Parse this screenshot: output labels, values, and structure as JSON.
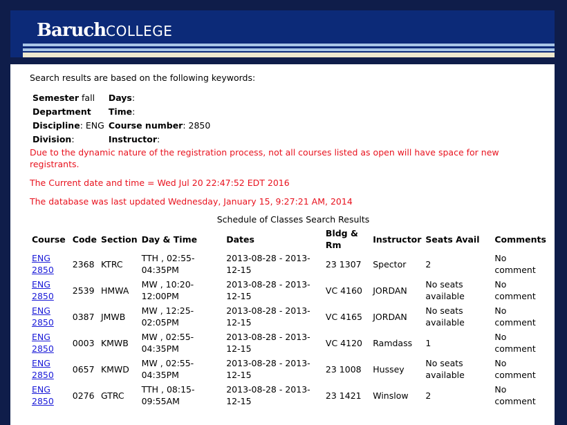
{
  "header": {
    "logo_bold": "Baruch",
    "logo_rest": "COLLEGE"
  },
  "colors": {
    "banner": "#0c2a78",
    "frame": "#0f1d4a",
    "stripe_light": "#a9c6e6",
    "stripe_cream": "#efe9cf",
    "warning": "#e8121e",
    "link": "#1a1ad8"
  },
  "intro": "Search results are based on the following keywords:",
  "criteria": {
    "semester_label": "Semester",
    "semester_value": "fall",
    "days_label": "Days",
    "days_value": "",
    "department_label": "Department",
    "time_label": "Time",
    "time_value": "",
    "discipline_label": "Discipline",
    "discipline_value": "ENG",
    "course_number_label": "Course number",
    "course_number_value": "2850",
    "division_label": "Division",
    "instructor_label": "Instructor",
    "instructor_value": ""
  },
  "notices": {
    "dynamic": "Due to the dynamic nature of the registration process, not all courses listed as open will have space for new registrants.",
    "current_time": "The Current date and time = Wed Jul 20 22:47:52 EDT 2016",
    "db_updated": "The database was last updated Wednesday, January 15, 9:27:21 AM, 2014"
  },
  "results": {
    "caption": "Schedule of Classes Search Results",
    "columns": [
      "Course",
      "Code",
      "Section",
      "Day & Time",
      "Dates",
      "Bldg & Rm",
      "Instructor",
      "Seats Avail",
      "Comments"
    ],
    "rows": [
      {
        "course": "ENG 2850",
        "code": "2368",
        "section": "KTRC",
        "day_time": "TTH , 02:55-04:35PM",
        "dates": "2013-08-28 - 2013-12-15",
        "room": "23 1307",
        "instructor": "Spector",
        "seats": "2",
        "comments": "No comment"
      },
      {
        "course": "ENG 2850",
        "code": "2539",
        "section": "HMWA",
        "day_time": "MW , 10:20-12:00PM",
        "dates": "2013-08-28 - 2013-12-15",
        "room": "VC 4160",
        "instructor": "JORDAN",
        "seats": "No seats available",
        "comments": "No comment"
      },
      {
        "course": "ENG 2850",
        "code": "0387",
        "section": "JMWB",
        "day_time": "MW , 12:25-02:05PM",
        "dates": "2013-08-28 - 2013-12-15",
        "room": "VC 4165",
        "instructor": "JORDAN",
        "seats": "No seats available",
        "comments": "No comment"
      },
      {
        "course": "ENG 2850",
        "code": "0003",
        "section": "KMWB",
        "day_time": "MW , 02:55-04:35PM",
        "dates": "2013-08-28 - 2013-12-15",
        "room": "VC 4120",
        "instructor": "Ramdass",
        "seats": "1",
        "comments": "No comment"
      },
      {
        "course": "ENG 2850",
        "code": "0657",
        "section": "KMWD",
        "day_time": "MW , 02:55-04:35PM",
        "dates": "2013-08-28 - 2013-12-15",
        "room": "23 1008",
        "instructor": "Hussey",
        "seats": "No seats available",
        "comments": "No comment"
      },
      {
        "course": "ENG 2850",
        "code": "0276",
        "section": "GTRC",
        "day_time": "TTH , 08:15-09:55AM",
        "dates": "2013-08-28 - 2013-12-15",
        "room": "23 1421",
        "instructor": "Winslow",
        "seats": "2",
        "comments": "No comment"
      }
    ]
  }
}
